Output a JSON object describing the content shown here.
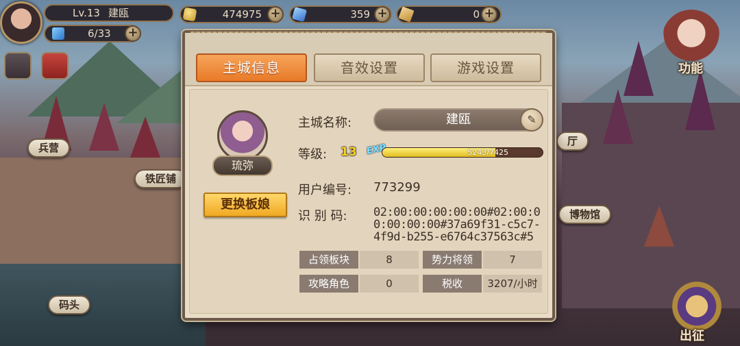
{
  "hud": {
    "level_text": "Lv.13",
    "city_name": "建瓯",
    "energy": "6/33",
    "gold": "474975",
    "gems": "359",
    "scrolls": "0",
    "plus": "+",
    "icons": {
      "avatar": "player-avatar",
      "gold": "gold-coin-icon",
      "gems": "blue-gem-icon",
      "scrolls": "scroll-icon",
      "energy": "energy-icon",
      "mail": "mail-icon",
      "notes": "notes-icon"
    }
  },
  "map": {
    "barracks": "兵营",
    "blacksmith": "铁匠铺",
    "museum": "博物馆",
    "dock": "码头",
    "partial_sign": "厅"
  },
  "side": {
    "function_label": "功能",
    "expedition_label": "出征"
  },
  "dialog": {
    "tabs": [
      {
        "label": "主城信息",
        "active": true
      },
      {
        "label": "音效设置",
        "active": false
      },
      {
        "label": "游戏设置",
        "active": false
      }
    ],
    "hero_name": "琉弥",
    "change_button": "更换板娘",
    "city_name_label": "主城名称:",
    "city_name_value": "建瓯",
    "level_label": "等级:",
    "level_value": "13",
    "exp_tag": "EXP",
    "exp_text": "5243/7425",
    "exp_fraction": 0.706,
    "user_id_label": "用户编号:",
    "user_id_value": "773299",
    "code_label": "识 别 码:",
    "code_value": "02:00:00:00:00:00#02:00:00:00:00:00#37a69f31-c5c7-4f9d-b255-e6764c37563c#5",
    "stats": {
      "territory_label": "占领板块",
      "territory_value": "8",
      "generals_label": "势力将领",
      "generals_value": "7",
      "conquered_label": "攻略角色",
      "conquered_value": "0",
      "tax_label": "税收",
      "tax_value": "3207/小时"
    }
  },
  "colors": {
    "active_tab": "#e87a28",
    "gold_button": "#f0a922",
    "exp_fill": "#e0bd1f",
    "level_number": "#ffd21f"
  }
}
